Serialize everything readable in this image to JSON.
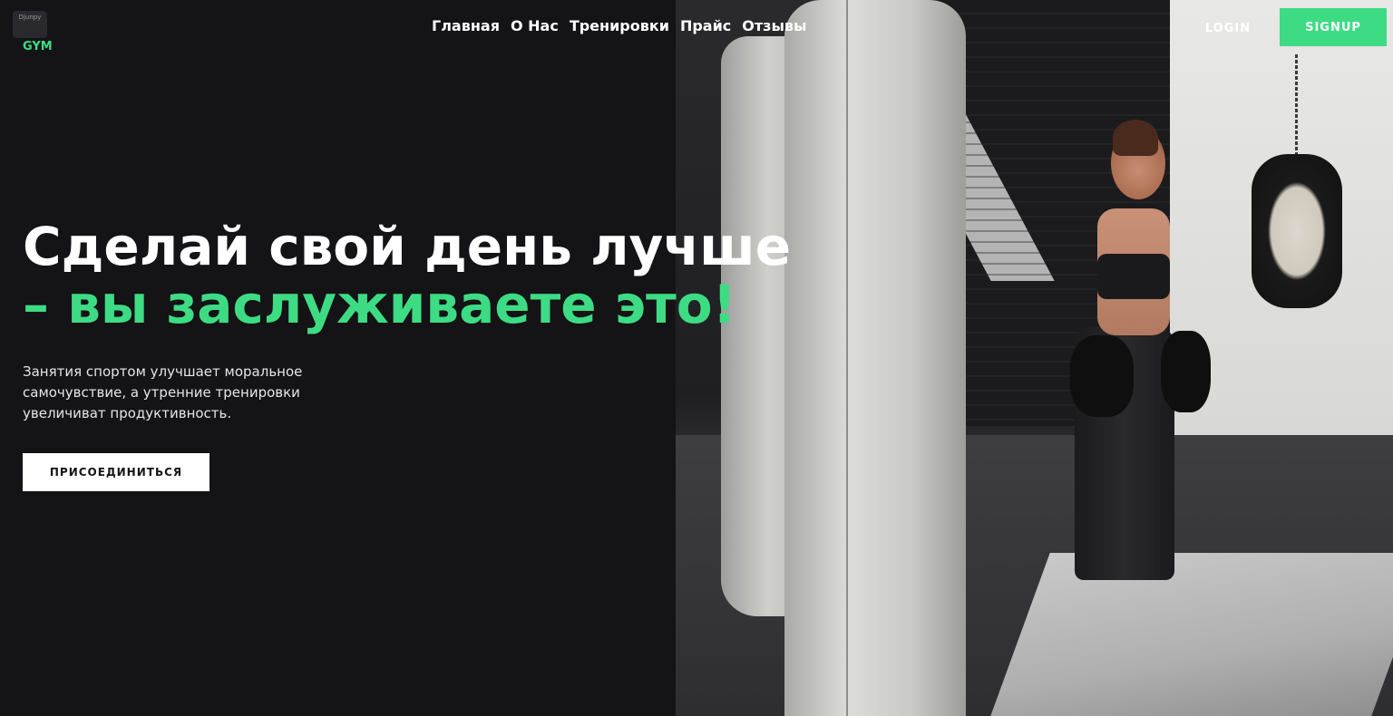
{
  "header": {
    "logo": {
      "box_text": "Djunpy",
      "gym_label": "GYM"
    },
    "nav": [
      "Главная",
      "О Нас",
      "Тренировки",
      "Прайс",
      "Отзывы"
    ],
    "login_label": "LOGIN",
    "signup_label": "SIGNUP"
  },
  "hero": {
    "title_line1": "Сделай свой день лучше",
    "title_line2": "– вы заслуживаете это!",
    "description": "Занятия спортом улучшает моральное самочувствие, а утренние тренировки увеличиват продуктивность.",
    "join_label": "ПРИСОЕДИНИТЬСЯ"
  },
  "colors": {
    "background": "#141316",
    "accent": "#3ddc84",
    "text": "#ffffff"
  },
  "icons": {
    "hero_image": "boxing-gym-photo"
  }
}
